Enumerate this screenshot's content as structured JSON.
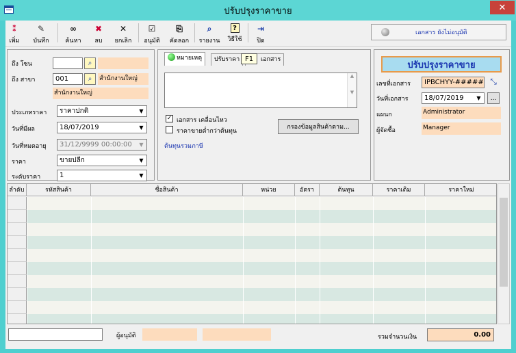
{
  "window": {
    "title": "ปรับปรุงราคาขาย",
    "close": "✕"
  },
  "toolbar": {
    "buttons": [
      {
        "name": "add",
        "label": "เพิ่ม",
        "icon": "add-icon"
      },
      {
        "name": "save",
        "label": "บันทึก",
        "icon": "save-icon"
      },
      {
        "name": "search",
        "label": "ค้นหา",
        "icon": "binoculars-icon"
      },
      {
        "name": "delete",
        "label": "ลบ",
        "icon": "delete-icon"
      },
      {
        "name": "cancel",
        "label": "ยกเลิก",
        "icon": "close-icon"
      },
      {
        "name": "approve",
        "label": "อนุมัติ",
        "icon": "approve-icon"
      },
      {
        "name": "copy",
        "label": "คัดลอก",
        "icon": "copy-icon"
      },
      {
        "name": "report",
        "label": "รายงาน",
        "icon": "report-icon"
      },
      {
        "name": "help",
        "label": "วิธีใช้",
        "icon": "help-icon"
      },
      {
        "name": "close",
        "label": "ปิด",
        "icon": "exit-icon"
      }
    ],
    "status": "เอกสาร ยังไม่อนุมัติ",
    "tooltip": "F1"
  },
  "left": {
    "to_zone_label": "ถึง โซน",
    "to_zone_value": "",
    "to_branch_label": "ถึง สาขา",
    "to_branch_value": "001",
    "branch_name": "สำนักงานใหญ่",
    "branch_name_full": "สำนักงานใหญ่",
    "price_type_label": "ประเภทราคา",
    "price_type_value": "ราคาปกติ",
    "effective_label": "วันที่มีผล",
    "effective_value": "18/07/2019",
    "expire_label": "วันที่หมดอายุ",
    "expire_value": "31/12/9999 00:00:00",
    "price_label": "ราคา",
    "price_value": "ขายปลีก",
    "level_label": "ระดับราคา",
    "level_value": "1"
  },
  "middle": {
    "tabs": [
      "หมายเหตุ",
      "ปรับราคา",
      "เอกสาร"
    ],
    "cb_moving_doc": "เอกสาร เคลื่อนไหว",
    "cb_moving_doc_checked": "✓",
    "cb_below_cost": "ราคาขายต่ำกว่าต้นทุน",
    "filter_button": "กรองข้อมูลสินค้าตาม...",
    "cost_link": "ต้นทุนรวมภาษี"
  },
  "right": {
    "title": "ปรับปรุงราคาขาย",
    "doc_no_label": "เลขที่เอกสาร",
    "doc_no_value": "IPBCHYY-######",
    "doc_date_label": "วันที่เอกสาร",
    "doc_date_value": "18/07/2019",
    "dept_label": "แผนก",
    "dept_value": "Administrator",
    "buyer_label": "ผู้จัดซื้อ",
    "buyer_value": "Manager",
    "more": "..."
  },
  "grid": {
    "headers": [
      "ลำดับ",
      "รหัสสินค้า",
      "ชื่อสินค้า",
      "หน่วย",
      "อัตรา",
      "ต้นทุน",
      "ราคาเดิม",
      "ราคาใหม่"
    ]
  },
  "footer": {
    "approver_label": "ผู้อนุมัติ",
    "total_label": "รวมจำนวนเงิน",
    "total_value": "0.00"
  }
}
